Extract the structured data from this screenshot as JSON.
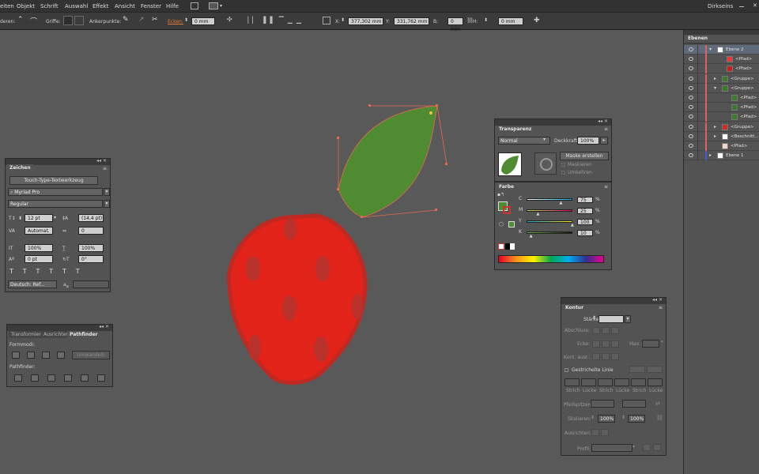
{
  "menubar": {
    "items": [
      "eiten",
      "Objekt",
      "Schrift",
      "Auswahl",
      "Effekt",
      "Ansicht",
      "Fenster",
      "Hilfe"
    ],
    "workspace": "Dirkseins"
  },
  "control_bar": {
    "label_anchor_prefix": "deren:",
    "label_handles": "Griffe:",
    "label_anchor_points": "Ankerpunkte:",
    "label_corners": "Ecken:",
    "corner_value": "0 mm",
    "x_label": "X:",
    "x_value": "377,302 mm",
    "y_label": "Y:",
    "y_value": "331,762 mm",
    "w_label": "B:",
    "w_value": "0 mm",
    "h_label": "H:",
    "h_value": "0 mm"
  },
  "zeichen_panel": {
    "title": "Zeichen",
    "touch_button": "Touch-Type-Textwerkzeug",
    "font_family": "Myriad Pro",
    "font_style": "Regular",
    "font_size": "12 pt",
    "leading": "(14,4 pt)",
    "kerning": "Automat.",
    "tracking": "0",
    "vscale": "100%",
    "hscale": "100%",
    "baseline": "0 pt",
    "rotation": "0°",
    "language": "Deutsch: Ref...",
    "aa": "a"
  },
  "pathfinder_panel": {
    "tabs": [
      "Transformieren",
      "Ausrichten",
      "Pathfinder"
    ],
    "formmodi_label": "Formmodi:",
    "expand_button": "Umwandeln",
    "pathfinder_label": "Pathfinder:"
  },
  "transparenz_panel": {
    "title": "Transparenz",
    "blend_mode": "Normal",
    "opacity_label": "Deckkraft:",
    "opacity_value": "100%",
    "mask_button": "Maske erstellen",
    "clip_label": "Maskieren",
    "invert_label": "Umkehren"
  },
  "farbe_panel": {
    "title": "Farbe",
    "channels": [
      {
        "label": "C",
        "value": "75",
        "unit": "%",
        "level": 0.75
      },
      {
        "label": "M",
        "value": "25",
        "unit": "%",
        "level": 0.25
      },
      {
        "label": "Y",
        "value": "100",
        "unit": "%",
        "level": 1.0
      },
      {
        "label": "K",
        "value": "10",
        "unit": "%",
        "level": 0.1
      }
    ],
    "fill_color": "#4d8c32"
  },
  "kontur_panel": {
    "title": "Kontur",
    "stroke_label": "Stärke:",
    "cap_label": "Abschluss:",
    "corner_label": "Ecke:",
    "limit_label": "Max.:",
    "align_label": "Kont. ausr.:",
    "dashed_label": "Gestrichelte Linie",
    "dash_labels": [
      "Strich",
      "Lücke",
      "Strich",
      "Lücke",
      "Strich",
      "Lücke"
    ],
    "arrow_label": "Pfeilspitzen:",
    "scale_label": "Skalieren:",
    "scale_1": "100%",
    "scale_2": "100%",
    "align_arrow_label": "Ausrichten:",
    "profile_label": "Profil:"
  },
  "layers_panel": {
    "title": "Ebenen",
    "rows": [
      {
        "name": "Ebene 2",
        "indent": 0,
        "expanded": "open",
        "thumb": "#ffffff",
        "bar": "#e06060"
      },
      {
        "name": "<Pfad>",
        "indent": 2,
        "expanded": "",
        "thumb": "#e8383a",
        "bar": "#e06060"
      },
      {
        "name": "<Pfad>",
        "indent": 2,
        "expanded": "",
        "thumb": "#c51f1f",
        "bar": "#e06060"
      },
      {
        "name": "<Gruppe>",
        "indent": 1,
        "expanded": "closed",
        "thumb": "#3a7a2a",
        "bar": "#e06060"
      },
      {
        "name": "<Gruppe>",
        "indent": 1,
        "expanded": "open",
        "thumb": "#3a7a2a",
        "bar": "#e06060"
      },
      {
        "name": "<Pfad>",
        "indent": 3,
        "expanded": "",
        "thumb": "#3a7a2a",
        "bar": "#e06060"
      },
      {
        "name": "<Pfad>",
        "indent": 3,
        "expanded": "",
        "thumb": "#3a7a2a",
        "bar": "#e06060"
      },
      {
        "name": "<Pfad>",
        "indent": 3,
        "expanded": "",
        "thumb": "#3a7a2a",
        "bar": "#e06060"
      },
      {
        "name": "<Gruppe>",
        "indent": 1,
        "expanded": "closed",
        "thumb": "#c83028",
        "bar": "#e06060"
      },
      {
        "name": "<Beschnitt...",
        "indent": 1,
        "expanded": "closed",
        "thumb": "#ffffff",
        "bar": "#e06060"
      },
      {
        "name": "<Pfad>",
        "indent": 1,
        "expanded": "",
        "thumb": "#f0d8c8",
        "bar": "#e06060"
      },
      {
        "name": "Ebene 1",
        "indent": 0,
        "expanded": "closed",
        "thumb": "#ffffff",
        "bar": "#4060d0"
      }
    ]
  }
}
